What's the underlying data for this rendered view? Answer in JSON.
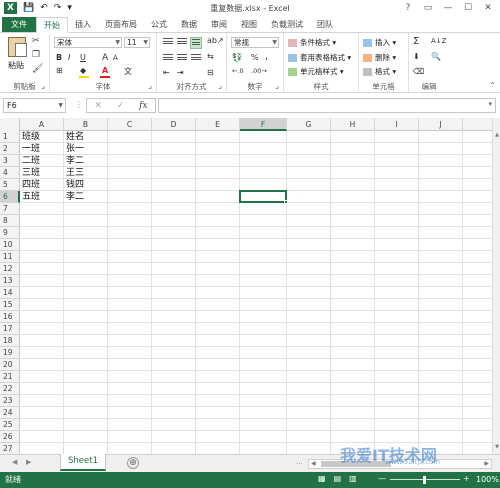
{
  "window": {
    "title": "重复数据.xlsx - Excel",
    "qat_save": "💾",
    "qat_undo": "↶",
    "qat_redo": "↷",
    "btn_help": "?",
    "btn_ribbon_display": "▭",
    "btn_minimize": "—",
    "btn_maximize": "☐",
    "btn_close": "✕"
  },
  "ribbon_tabs": [
    "文件",
    "开始",
    "插入",
    "页面布局",
    "公式",
    "数据",
    "审阅",
    "视图",
    "负载测试",
    "团队"
  ],
  "ribbon": {
    "clipboard": {
      "label": "剪贴板",
      "paste": "粘贴"
    },
    "font": {
      "label": "字体",
      "font_name": "宋体",
      "font_size": "11",
      "bold": "B",
      "italic": "I",
      "underline": "U",
      "grow": "A",
      "shrink": "A"
    },
    "alignment": {
      "label": "对齐方式"
    },
    "number": {
      "label": "数字",
      "format": "常规",
      "percent": "%",
      "comma": ","
    },
    "styles": {
      "label": "样式",
      "conditional": "条件格式 ▾",
      "table": "套用表格格式 ▾",
      "cell_styles": "单元格样式 ▾"
    },
    "cells": {
      "label": "单元格",
      "insert": "插入",
      "delete": "删除",
      "format": "格式"
    },
    "editing": {
      "label": "编辑",
      "sum": "Σ",
      "sort": "A↓Z",
      "find": "🔍"
    }
  },
  "formula_bar": {
    "name_box": "F6",
    "cancel": "✕",
    "enter": "✓",
    "fx": "fx",
    "formula": ""
  },
  "grid": {
    "columns": [
      "A",
      "B",
      "C",
      "D",
      "E",
      "F",
      "G",
      "H",
      "I",
      "J"
    ],
    "selected_column": "F",
    "rows": [
      "1",
      "2",
      "3",
      "4",
      "5",
      "6",
      "7",
      "8",
      "9",
      "10",
      "11",
      "12",
      "13",
      "14",
      "15",
      "16",
      "17",
      "18",
      "19",
      "20",
      "21",
      "22",
      "23",
      "24",
      "25",
      "26",
      "27"
    ],
    "selected_row": "6",
    "cells": [
      [
        "班级",
        "姓名"
      ],
      [
        "一班",
        "张一"
      ],
      [
        "二班",
        "李二"
      ],
      [
        "三班",
        "王三"
      ],
      [
        "四班",
        "钱四"
      ],
      [
        "五班",
        "李二"
      ]
    ]
  },
  "sheets": {
    "tabs": [
      "Sheet1"
    ],
    "add": "⊕",
    "nav_prev": "◀",
    "nav_next": "▶",
    "more": "..."
  },
  "status": {
    "ready": "就绪",
    "zoom_minus": "—",
    "zoom_plus": "+",
    "zoom": "100%"
  },
  "watermark": {
    "text": "我爱IT技术网",
    "sub": "www.52itjs.com"
  },
  "colors": {
    "excel_green": "#217346",
    "font_red": "#e02020",
    "fill_yellow": "#ffd800"
  }
}
